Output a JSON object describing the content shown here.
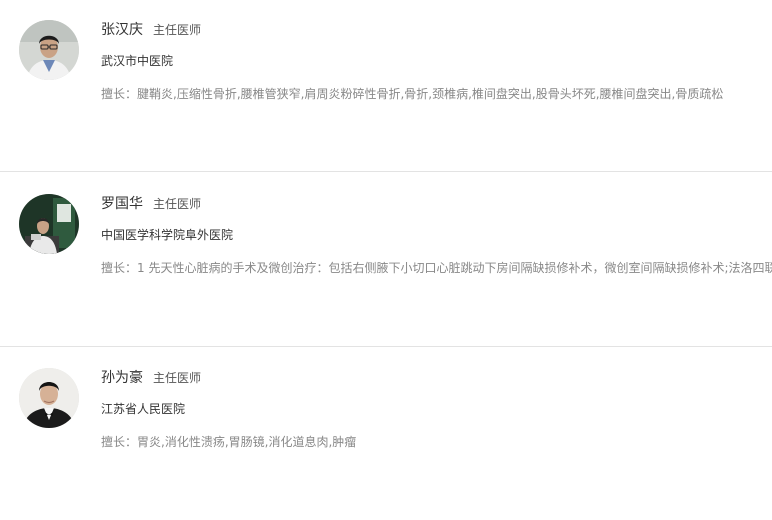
{
  "doctors": [
    {
      "name": "张汉庆",
      "title": "主任医师",
      "hospital": "武汉市中医院",
      "specialty": "擅长：腱鞘炎,压缩性骨折,腰椎管狭窄,肩周炎粉碎性骨折,骨折,颈椎病,椎间盘突出,股骨头坏死,腰椎间盘突出,骨质疏松"
    },
    {
      "name": "罗国华",
      "title": "主任医师",
      "hospital": "中国医学科学院阜外医院",
      "specialty": "擅长：1 先天性心脏病的手术及微创治疗：包括右侧腋下小切口心脏跳动下房间隔缺损修补术，微创室间隔缺损修补术;法洛四联"
    },
    {
      "name": "孙为豪",
      "title": "主任医师",
      "hospital": "江苏省人民医院",
      "specialty": "擅长：胃炎,消化性溃疡,胃肠镜,消化道息肉,肿瘤"
    }
  ],
  "avatars": [
    {
      "icon": "doctor-photo-icon",
      "bg": "#cfd3d0",
      "skin": "#caa58a",
      "hair": "#1d1d1d",
      "clothes": "#f4f4f4"
    },
    {
      "icon": "doctor-photo-icon",
      "bg": "#1f3a2a",
      "skin": "#c9a488",
      "hair": "#2a2a2a",
      "clothes": "#e8e8e8"
    },
    {
      "icon": "doctor-photo-icon",
      "bg": "#ecebe8",
      "skin": "#d8b49a",
      "hair": "#141414",
      "clothes": "#1a1a1a"
    }
  ]
}
